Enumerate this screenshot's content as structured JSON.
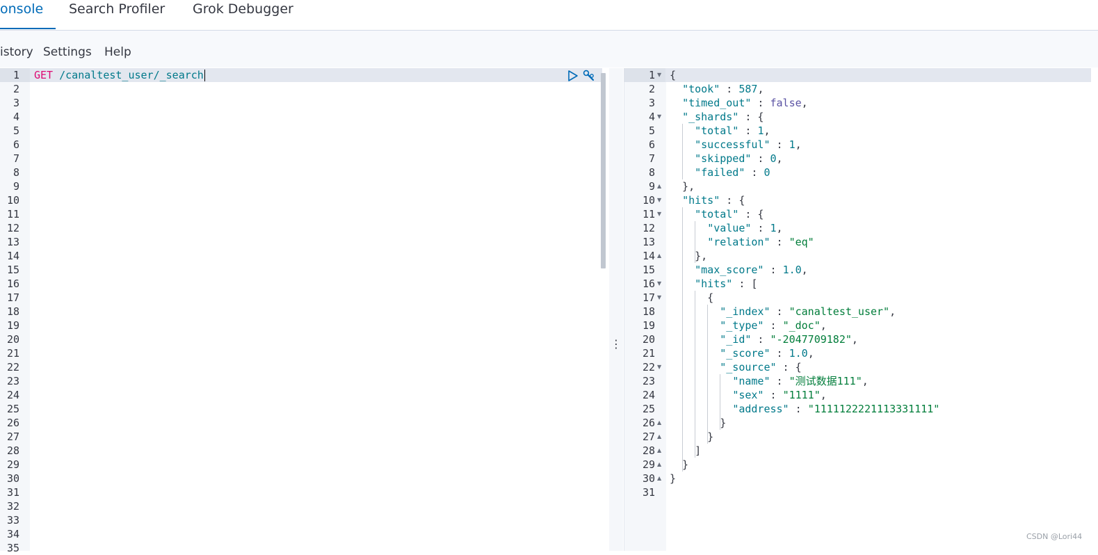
{
  "tabs": [
    {
      "label": "onsole",
      "active": true
    },
    {
      "label": "Search Profiler",
      "active": false
    },
    {
      "label": "Grok Debugger",
      "active": false
    }
  ],
  "menu": {
    "history": "istory",
    "settings": "Settings",
    "help": "Help"
  },
  "request": {
    "method": "GET",
    "path": " /canaltest_user/_search",
    "line_numbers": [
      "1",
      "2",
      "3",
      "4",
      "5",
      "6",
      "7",
      "8",
      "9",
      "10",
      "11",
      "12",
      "13",
      "14",
      "15",
      "16",
      "17",
      "18",
      "19",
      "20",
      "21",
      "22",
      "23",
      "24",
      "25",
      "26",
      "27",
      "28",
      "29",
      "30",
      "31",
      "32",
      "33",
      "34",
      "35"
    ],
    "run_icon": "play-icon",
    "wrench_icon": "wrench-icon"
  },
  "response": {
    "line_numbers": [
      "1",
      "2",
      "3",
      "4",
      "5",
      "6",
      "7",
      "8",
      "9",
      "10",
      "11",
      "12",
      "13",
      "14",
      "15",
      "16",
      "17",
      "18",
      "19",
      "20",
      "21",
      "22",
      "23",
      "24",
      "25",
      "26",
      "27",
      "28",
      "29",
      "30",
      "31"
    ],
    "folds": {
      "1": "down",
      "4": "down",
      "9": "up",
      "10": "down",
      "11": "down",
      "14": "up",
      "16": "down",
      "17": "down",
      "22": "down",
      "26": "up",
      "27": "up",
      "28": "up",
      "29": "up",
      "30": "up"
    },
    "lines": [
      [
        {
          "t": "p",
          "v": "{"
        }
      ],
      [
        {
          "t": "p",
          "v": "  "
        },
        {
          "t": "k",
          "v": "\"took\""
        },
        {
          "t": "p",
          "v": " : "
        },
        {
          "t": "n",
          "v": "587"
        },
        {
          "t": "p",
          "v": ","
        }
      ],
      [
        {
          "t": "p",
          "v": "  "
        },
        {
          "t": "k",
          "v": "\"timed_out\""
        },
        {
          "t": "p",
          "v": " : "
        },
        {
          "t": "b",
          "v": "false"
        },
        {
          "t": "p",
          "v": ","
        }
      ],
      [
        {
          "t": "p",
          "v": "  "
        },
        {
          "t": "k",
          "v": "\"_shards\""
        },
        {
          "t": "p",
          "v": " : {"
        }
      ],
      [
        {
          "t": "p",
          "v": "    "
        },
        {
          "t": "k",
          "v": "\"total\""
        },
        {
          "t": "p",
          "v": " : "
        },
        {
          "t": "n",
          "v": "1"
        },
        {
          "t": "p",
          "v": ","
        }
      ],
      [
        {
          "t": "p",
          "v": "    "
        },
        {
          "t": "k",
          "v": "\"successful\""
        },
        {
          "t": "p",
          "v": " : "
        },
        {
          "t": "n",
          "v": "1"
        },
        {
          "t": "p",
          "v": ","
        }
      ],
      [
        {
          "t": "p",
          "v": "    "
        },
        {
          "t": "k",
          "v": "\"skipped\""
        },
        {
          "t": "p",
          "v": " : "
        },
        {
          "t": "n",
          "v": "0"
        },
        {
          "t": "p",
          "v": ","
        }
      ],
      [
        {
          "t": "p",
          "v": "    "
        },
        {
          "t": "k",
          "v": "\"failed\""
        },
        {
          "t": "p",
          "v": " : "
        },
        {
          "t": "n",
          "v": "0"
        }
      ],
      [
        {
          "t": "p",
          "v": "  },"
        }
      ],
      [
        {
          "t": "p",
          "v": "  "
        },
        {
          "t": "k",
          "v": "\"hits\""
        },
        {
          "t": "p",
          "v": " : {"
        }
      ],
      [
        {
          "t": "p",
          "v": "    "
        },
        {
          "t": "k",
          "v": "\"total\""
        },
        {
          "t": "p",
          "v": " : {"
        }
      ],
      [
        {
          "t": "p",
          "v": "      "
        },
        {
          "t": "k",
          "v": "\"value\""
        },
        {
          "t": "p",
          "v": " : "
        },
        {
          "t": "n",
          "v": "1"
        },
        {
          "t": "p",
          "v": ","
        }
      ],
      [
        {
          "t": "p",
          "v": "      "
        },
        {
          "t": "k",
          "v": "\"relation\""
        },
        {
          "t": "p",
          "v": " : "
        },
        {
          "t": "s",
          "v": "\"eq\""
        }
      ],
      [
        {
          "t": "p",
          "v": "    },"
        }
      ],
      [
        {
          "t": "p",
          "v": "    "
        },
        {
          "t": "k",
          "v": "\"max_score\""
        },
        {
          "t": "p",
          "v": " : "
        },
        {
          "t": "n",
          "v": "1.0"
        },
        {
          "t": "p",
          "v": ","
        }
      ],
      [
        {
          "t": "p",
          "v": "    "
        },
        {
          "t": "k",
          "v": "\"hits\""
        },
        {
          "t": "p",
          "v": " : ["
        }
      ],
      [
        {
          "t": "p",
          "v": "      {"
        }
      ],
      [
        {
          "t": "p",
          "v": "        "
        },
        {
          "t": "k",
          "v": "\"_index\""
        },
        {
          "t": "p",
          "v": " : "
        },
        {
          "t": "s",
          "v": "\"canaltest_user\""
        },
        {
          "t": "p",
          "v": ","
        }
      ],
      [
        {
          "t": "p",
          "v": "        "
        },
        {
          "t": "k",
          "v": "\"_type\""
        },
        {
          "t": "p",
          "v": " : "
        },
        {
          "t": "s",
          "v": "\"_doc\""
        },
        {
          "t": "p",
          "v": ","
        }
      ],
      [
        {
          "t": "p",
          "v": "        "
        },
        {
          "t": "k",
          "v": "\"_id\""
        },
        {
          "t": "p",
          "v": " : "
        },
        {
          "t": "s",
          "v": "\"-2047709182\""
        },
        {
          "t": "p",
          "v": ","
        }
      ],
      [
        {
          "t": "p",
          "v": "        "
        },
        {
          "t": "k",
          "v": "\"_score\""
        },
        {
          "t": "p",
          "v": " : "
        },
        {
          "t": "n",
          "v": "1.0"
        },
        {
          "t": "p",
          "v": ","
        }
      ],
      [
        {
          "t": "p",
          "v": "        "
        },
        {
          "t": "k",
          "v": "\"_source\""
        },
        {
          "t": "p",
          "v": " : {"
        }
      ],
      [
        {
          "t": "p",
          "v": "          "
        },
        {
          "t": "k",
          "v": "\"name\""
        },
        {
          "t": "p",
          "v": " : "
        },
        {
          "t": "s",
          "v": "\"测试数据111\""
        },
        {
          "t": "p",
          "v": ","
        }
      ],
      [
        {
          "t": "p",
          "v": "          "
        },
        {
          "t": "k",
          "v": "\"sex\""
        },
        {
          "t": "p",
          "v": " : "
        },
        {
          "t": "s",
          "v": "\"1111\""
        },
        {
          "t": "p",
          "v": ","
        }
      ],
      [
        {
          "t": "p",
          "v": "          "
        },
        {
          "t": "k",
          "v": "\"address\""
        },
        {
          "t": "p",
          "v": " : "
        },
        {
          "t": "s",
          "v": "\"1111122221113331111\""
        }
      ],
      [
        {
          "t": "p",
          "v": "        }"
        }
      ],
      [
        {
          "t": "p",
          "v": "      }"
        }
      ],
      [
        {
          "t": "p",
          "v": "    ]"
        }
      ],
      [
        {
          "t": "p",
          "v": "  }"
        }
      ],
      [
        {
          "t": "p",
          "v": "}"
        }
      ],
      []
    ]
  },
  "watermark": "CSDN @Lori44",
  "colors": {
    "accent": "#006bb8",
    "key": "#00798a",
    "string": "#017d3a",
    "bool": "#5a52a3",
    "method": "#dd0a73"
  }
}
